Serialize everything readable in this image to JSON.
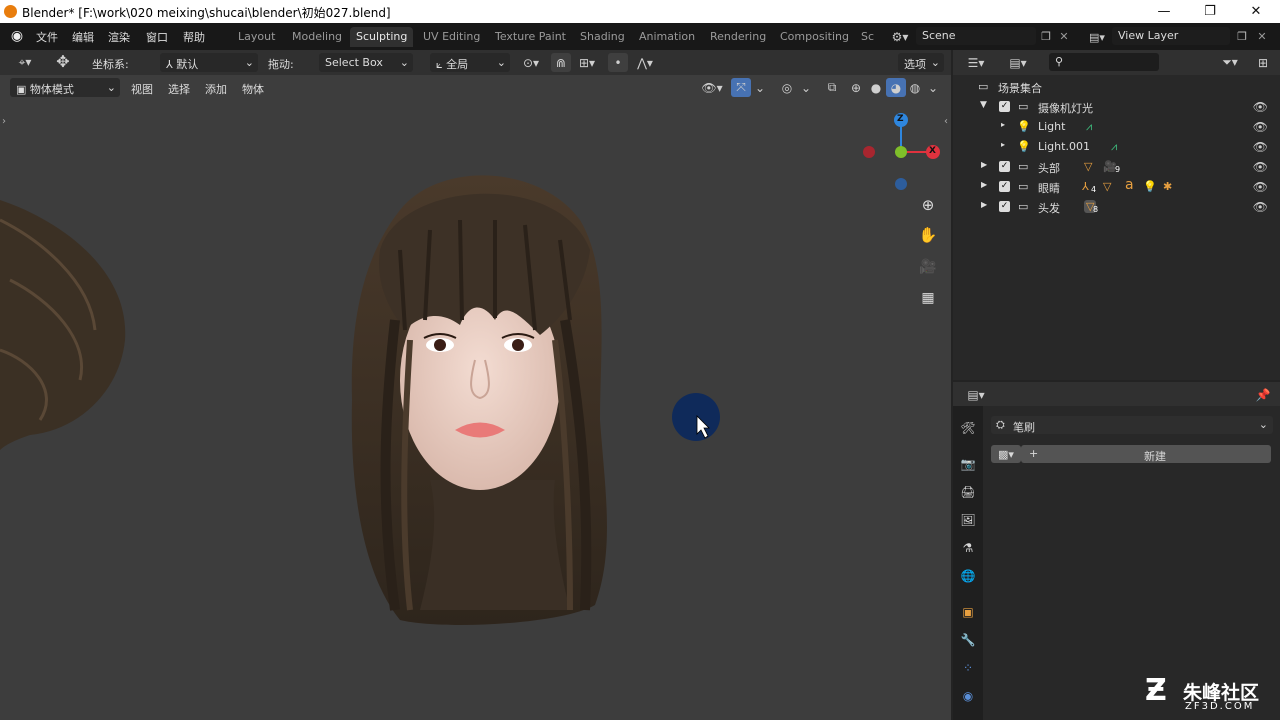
{
  "window": {
    "title": "Blender* [F:\\work\\020 meixing\\shucai\\blender\\初始027.blend]",
    "controls": [
      "—",
      "❐",
      "✕"
    ]
  },
  "menu": [
    "文件",
    "编辑",
    "渲染",
    "窗口",
    "帮助"
  ],
  "workspaces": [
    {
      "label": "Layout",
      "active": false
    },
    {
      "label": "Modeling",
      "active": false
    },
    {
      "label": "Sculpting",
      "active": true
    },
    {
      "label": "UV Editing",
      "active": false
    },
    {
      "label": "Texture Paint",
      "active": false
    },
    {
      "label": "Shading",
      "active": false
    },
    {
      "label": "Animation",
      "active": false
    },
    {
      "label": "Rendering",
      "active": false
    },
    {
      "label": "Compositing",
      "active": false
    },
    {
      "label": "Sc",
      "active": false
    }
  ],
  "scene": {
    "name": "Scene",
    "view_layer": "View Layer"
  },
  "tool_header": {
    "orientation_label": "坐标系:",
    "orientation_value": "默认",
    "drag_label": "拖动:",
    "drag_value": "Select Box",
    "pivot_value": "全局",
    "options_label": "选项"
  },
  "view_header": {
    "mode": "物体模式",
    "menus": [
      "视图",
      "选择",
      "添加",
      "物体"
    ]
  },
  "outliner": {
    "search_placeholder": "",
    "root": "场景集合",
    "rows": [
      {
        "name": "摄像机灯光",
        "level": 1,
        "expanded": true
      },
      {
        "name": "Light",
        "level": 2
      },
      {
        "name": "Light.001",
        "level": 2
      },
      {
        "name": "头部",
        "level": 1,
        "badge": "9"
      },
      {
        "name": "眼睛",
        "level": 1,
        "badge": "4"
      },
      {
        "name": "头发",
        "level": 1,
        "badge": "8"
      }
    ]
  },
  "properties": {
    "brush_label": "笔刷",
    "new_label": "新建"
  },
  "gizmo": {
    "z": "Z",
    "x": "X"
  },
  "watermark": {
    "cn": "朱峰社区",
    "en": "ZF3D.COM"
  },
  "colors": {
    "accent": "#4772b3",
    "active_tab": "#303030",
    "viewport": "#3d3d3d",
    "orange": "#e87d0d"
  }
}
